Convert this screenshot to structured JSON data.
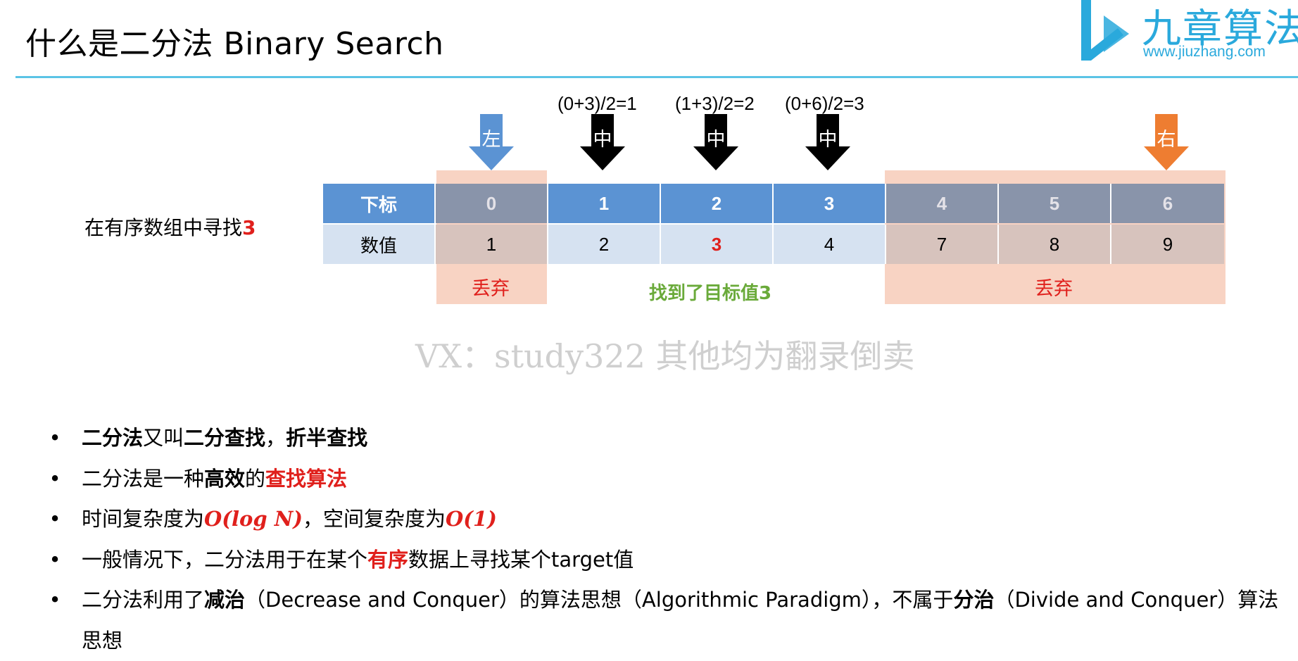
{
  "title": "什么是二分法 Binary Search",
  "logo": {
    "cn": "九章算法",
    "url": "www.jiuzhang.com"
  },
  "colors": {
    "accent_line": "#5bc4e6",
    "header_blue": "#5b93d3",
    "header_gray": "#8994aa",
    "value_blue": "#d6e2f1",
    "value_discard": "#d7c3bd",
    "discard_bg": "#f8d3c3",
    "highlight_red": "#e0201c",
    "found_green": "#6aaa3a",
    "left_arrow": "#5b93d3",
    "right_arrow": "#ee7d31",
    "mid_arrow": "#000000"
  },
  "diagram": {
    "formulas": [
      "(0+3)/2=1",
      "(1+3)/2=2",
      "(0+6)/2=3"
    ],
    "arrows": {
      "left": "左",
      "mid": "中",
      "right": "右"
    },
    "side_label": {
      "text": "在有序数组中寻找",
      "target": "3"
    },
    "row_labels": {
      "index": "下标",
      "value": "数值"
    },
    "indices": [
      "0",
      "1",
      "2",
      "3",
      "4",
      "5",
      "6"
    ],
    "values": [
      "1",
      "2",
      "3",
      "4",
      "7",
      "8",
      "9"
    ],
    "discard_left": "丢弃",
    "found": "找到了目标值3",
    "discard_right": "丢弃"
  },
  "watermark": "VX：study322 其他均为翻录倒卖",
  "bullets": {
    "b1": {
      "p1": "二分法",
      "p2": "又叫",
      "p3": "二分查找",
      "p4": "，",
      "p5": "折半查找"
    },
    "b2": {
      "p1": "二分法是一种",
      "p2": "高效",
      "p3": "的",
      "p4": "查找算法"
    },
    "b3": {
      "p1": "时间复杂度为",
      "p2": "O(log N)",
      "p3": "，空间复杂度为",
      "p4": "O(1)"
    },
    "b4": {
      "p1": "一般情况下，二分法用于在某个",
      "p2": "有序",
      "p3": "数据上寻找某个target值"
    },
    "b5": {
      "p1": "二分法利用了",
      "p2": "减治",
      "p3": "（Decrease and Conquer）的算法思想（Algorithmic Paradigm），不属于",
      "p4": "分治",
      "p5": "（Divide and Conquer）算法思想"
    },
    "bullet_char": "•"
  }
}
